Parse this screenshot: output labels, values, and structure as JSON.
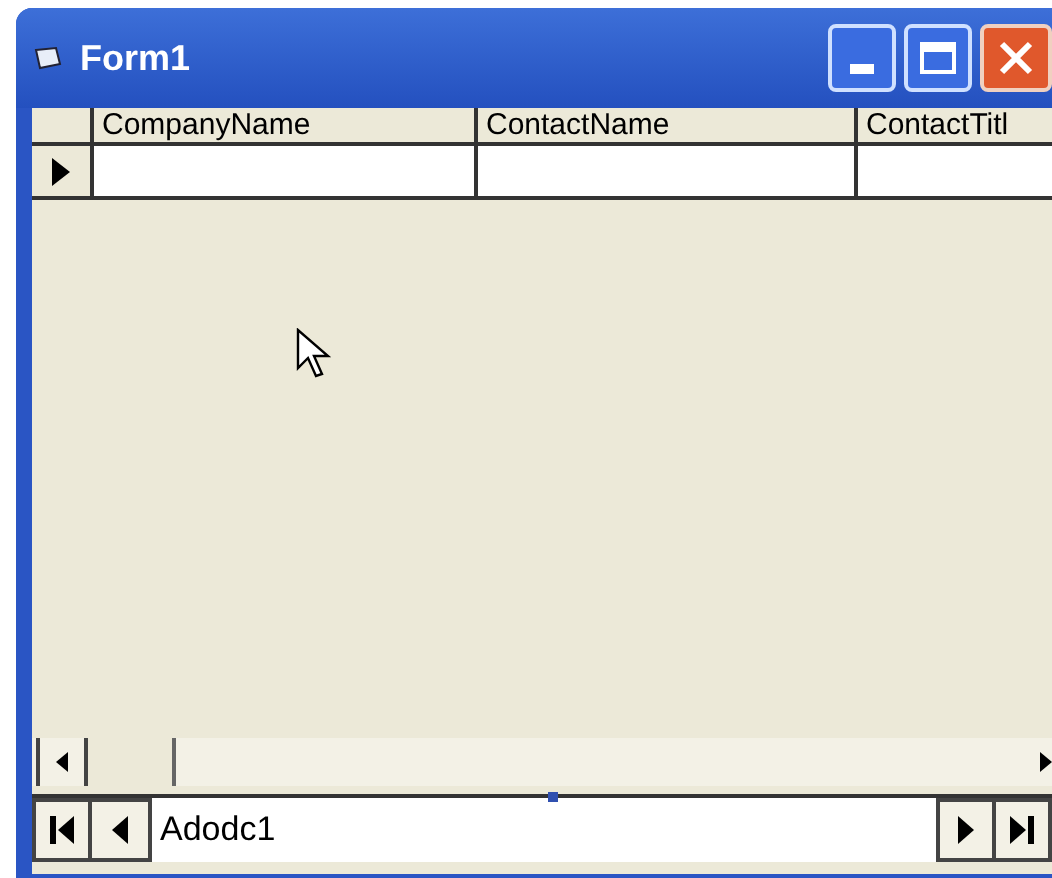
{
  "window": {
    "title": "Form1"
  },
  "grid": {
    "columns": [
      "CompanyName",
      "ContactName",
      "ContactTitl"
    ],
    "rows": [
      {
        "current": true,
        "cells": [
          "",
          "",
          ""
        ]
      }
    ]
  },
  "adodc": {
    "caption": "Adodc1"
  }
}
